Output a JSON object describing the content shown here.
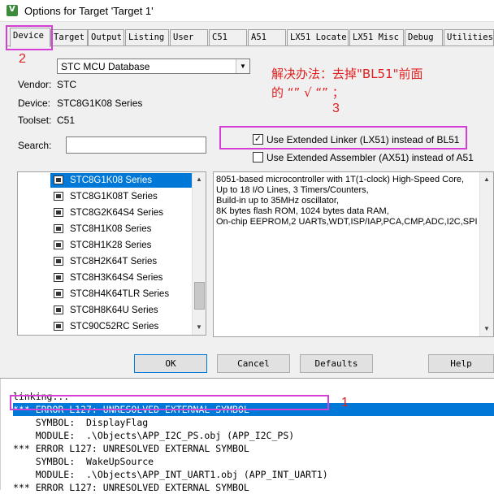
{
  "window": {
    "title": "Options for Target 'Target 1'"
  },
  "tabs": [
    "Device",
    "Target",
    "Output",
    "Listing",
    "User",
    "C51",
    "A51",
    "LX51 Locate",
    "LX51 Misc",
    "Debug",
    "Utilities"
  ],
  "device": {
    "database": "STC MCU Database",
    "vendor_label": "Vendor:",
    "vendor": "STC",
    "device_label": "Device:",
    "device": "STC8G1K08 Series",
    "toolset_label": "Toolset:",
    "toolset": "C51",
    "search_label": "Search:",
    "search_value": ""
  },
  "options": {
    "use_lx51": {
      "label": "Use Extended Linker (LX51) instead of BL51",
      "checked": true
    },
    "use_ax51": {
      "label": "Use Extended Assembler (AX51) instead of A51",
      "checked": false
    }
  },
  "annotations": {
    "num_tab": "2",
    "num_option": "3",
    "num_error": "1",
    "note_line1": "解决办法：去掉\"BL51\"前面",
    "note_line2": "的 “” √ “” ；"
  },
  "device_list": [
    "STC8G1K08 Series",
    "STC8G1K08T Series",
    "STC8G2K64S4 Series",
    "STC8H1K08 Series",
    "STC8H1K28 Series",
    "STC8H2K64T Series",
    "STC8H3K64S4 Series",
    "STC8H4K64TLR Series",
    "STC8H8K64U Series",
    "STC90C52RC Series"
  ],
  "selected_device_index": 0,
  "description": [
    "8051-based microcontroller with 1T(1-clock) High-Speed Core,",
    "Up to 18 I/O Lines, 3 Timers/Counters,",
    "Build-in up to 35MHz oscillator,",
    "8K bytes flash ROM, 1024 bytes data RAM,",
    "On-chip EEPROM,2 UARTs,WDT,ISP/IAP,PCA,CMP,ADC,I2C,SPI"
  ],
  "buttons": {
    "ok": "OK",
    "cancel": "Cancel",
    "defaults": "Defaults",
    "help": "Help"
  },
  "output": [
    "linking...",
    "*** ERROR L127: UNRESOLVED EXTERNAL SYMBOL",
    "    SYMBOL:  DisplayFlag",
    "    MODULE:  .\\Objects\\APP_I2C_PS.obj (APP_I2C_PS)",
    "*** ERROR L127: UNRESOLVED EXTERNAL SYMBOL",
    "    SYMBOL:  WakeUpSource",
    "    MODULE:  .\\Objects\\APP_INT_UART1.obj (APP_INT_UART1)",
    "*** ERROR L127: UNRESOLVED EXTERNAL SYMBOL"
  ],
  "selected_output_index": 1,
  "colors": {
    "annotation": "#e02020",
    "highlight_box": "#d63fd6",
    "selection": "#0078d7"
  }
}
